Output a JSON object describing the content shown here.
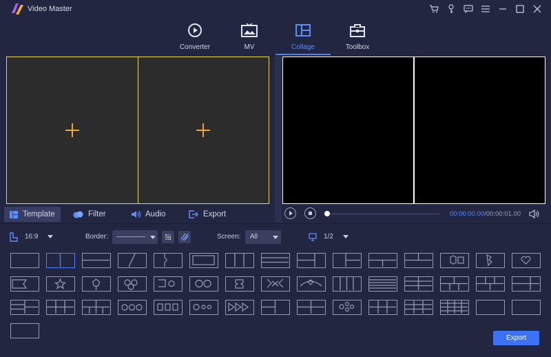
{
  "app": {
    "title": "Video Master"
  },
  "nav": [
    {
      "label": "Converter"
    },
    {
      "label": "MV"
    },
    {
      "label": "Collage"
    },
    {
      "label": "Toolbox"
    }
  ],
  "tabs": [
    {
      "label": "Template"
    },
    {
      "label": "Filter"
    },
    {
      "label": "Audio"
    },
    {
      "label": "Export"
    }
  ],
  "player": {
    "current_time": "00:00:00.00",
    "total_time": "/00:00:01.00",
    "progress": 0
  },
  "options": {
    "aspect": "16:9",
    "border_label": "Border:",
    "screen_label": "Screen:",
    "screen_value": "All",
    "page": "1/2"
  },
  "templates": {
    "count": 46,
    "selected_index": 1
  },
  "colors": {
    "accent": "#4f82ff",
    "editor_border": "#e6d75a",
    "plus": "#f3a52a",
    "background": "#222641"
  },
  "export_button": {
    "label": "Export"
  }
}
